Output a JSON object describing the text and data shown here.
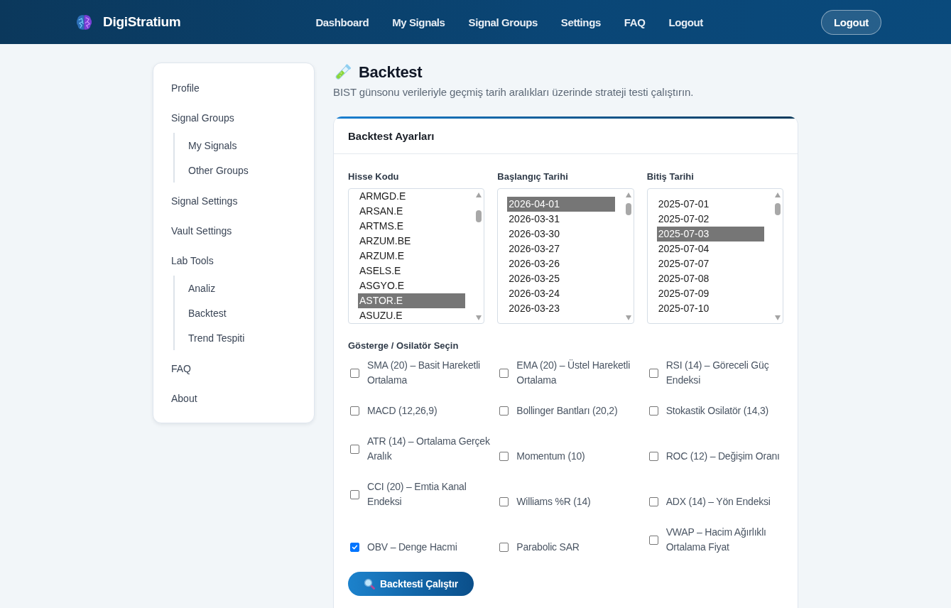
{
  "header": {
    "brand": "DigiStratium",
    "nav": [
      "Dashboard",
      "My Signals",
      "Signal Groups",
      "Settings",
      "FAQ",
      "Logout"
    ],
    "logout_button": "Logout"
  },
  "sidebar": {
    "items": [
      {
        "label": "Profile"
      },
      {
        "label": "Signal Groups",
        "children": [
          {
            "label": "My Signals"
          },
          {
            "label": "Other Groups"
          }
        ]
      },
      {
        "label": "Signal Settings"
      },
      {
        "label": "Vault Settings"
      },
      {
        "label": "Lab Tools",
        "children": [
          {
            "label": "Analiz"
          },
          {
            "label": "Backtest"
          },
          {
            "label": "Trend Tespiti"
          }
        ]
      },
      {
        "label": "FAQ"
      },
      {
        "label": "About"
      }
    ]
  },
  "page": {
    "title": "Backtest",
    "subtitle": "BIST günsonu verileriyle geçmiş tarih aralıkları üzerinde strateji testi çalıştırın."
  },
  "settings_card": {
    "title": "Backtest Ayarları",
    "fields": [
      {
        "label": "Hisse Kodu",
        "options": [
          {
            "text": "ARMGD.E",
            "selected": false
          },
          {
            "text": "ARSAN.E",
            "selected": false
          },
          {
            "text": "ARTMS.E",
            "selected": false
          },
          {
            "text": "ARZUM.BE",
            "selected": false
          },
          {
            "text": "ARZUM.E",
            "selected": false
          },
          {
            "text": "ASELS.E",
            "selected": false
          },
          {
            "text": "ASGYO.E",
            "selected": false
          },
          {
            "text": "ASTOR.E",
            "selected": true
          },
          {
            "text": "ASUZU.E",
            "selected": false
          }
        ]
      },
      {
        "label": "Başlangıç Tarihi",
        "options": [
          {
            "text": "2026-04-01",
            "selected": true
          },
          {
            "text": "2026-03-31",
            "selected": false
          },
          {
            "text": "2026-03-30",
            "selected": false
          },
          {
            "text": "2026-03-27",
            "selected": false
          },
          {
            "text": "2026-03-26",
            "selected": false
          },
          {
            "text": "2026-03-25",
            "selected": false
          },
          {
            "text": "2026-03-24",
            "selected": false
          },
          {
            "text": "2026-03-23",
            "selected": false
          }
        ]
      },
      {
        "label": "Bitiş Tarihi",
        "options": [
          {
            "text": "2025-07-01",
            "selected": false
          },
          {
            "text": "2025-07-02",
            "selected": false
          },
          {
            "text": "2025-07-03",
            "selected": true
          },
          {
            "text": "2025-07-04",
            "selected": false
          },
          {
            "text": "2025-07-07",
            "selected": false
          },
          {
            "text": "2025-07-08",
            "selected": false
          },
          {
            "text": "2025-07-09",
            "selected": false
          },
          {
            "text": "2025-07-10",
            "selected": false
          }
        ]
      }
    ],
    "indicators": {
      "label": "Gösterge / Osilatör Seçin",
      "items": [
        {
          "label": "SMA (20) – Basit Hareketli Ortalama",
          "checked": false
        },
        {
          "label": "EMA (20) – Üstel Hareketli Ortalama",
          "checked": false
        },
        {
          "label": "RSI (14) – Göreceli Güç Endeksi",
          "checked": false
        },
        {
          "label": "MACD (12,26,9)",
          "checked": false
        },
        {
          "label": "Bollinger Bantları (20,2)",
          "checked": false
        },
        {
          "label": "Stokastik Osilatör (14,3)",
          "checked": false
        },
        {
          "label": "ATR (14) – Ortalama Gerçek Aralık",
          "checked": false
        },
        {
          "label": "Momentum (10)",
          "checked": false
        },
        {
          "label": "ROC (12) – Değişim Oranı",
          "checked": false
        },
        {
          "label": "CCI (20) – Emtia Kanal Endeksi",
          "checked": false
        },
        {
          "label": "Williams %R (14)",
          "checked": false
        },
        {
          "label": "ADX (14) – Yön Endeksi",
          "checked": false
        },
        {
          "label": "OBV – Denge Hacmi",
          "checked": true
        },
        {
          "label": "Parabolic SAR",
          "checked": false
        },
        {
          "label": "VWAP – Hacim Ağırlıklı Ortalama Fiyat",
          "checked": false
        }
      ]
    },
    "run_button": "Backtesti Çalıştır"
  }
}
